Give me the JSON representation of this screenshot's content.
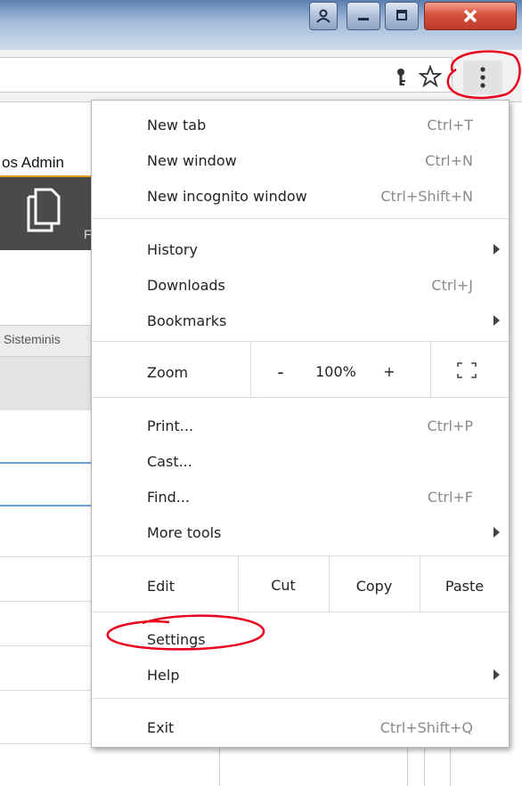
{
  "browser_ui": {
    "left_tab_text": "os Admin",
    "left_tab_text2": "Sisteminis",
    "left_icon_text": "F"
  },
  "menu": {
    "new_tab": {
      "label": "New tab",
      "shortcut": "Ctrl+T"
    },
    "new_window": {
      "label": "New window",
      "shortcut": "Ctrl+N"
    },
    "incognito": {
      "label": "New incognito window",
      "shortcut": "Ctrl+Shift+N"
    },
    "history": {
      "label": "History"
    },
    "downloads": {
      "label": "Downloads",
      "shortcut": "Ctrl+J"
    },
    "bookmarks": {
      "label": "Bookmarks"
    },
    "zoom": {
      "label": "Zoom",
      "minus": "-",
      "value": "100%",
      "plus": "+"
    },
    "print": {
      "label": "Print...",
      "shortcut": "Ctrl+P"
    },
    "cast": {
      "label": "Cast..."
    },
    "find": {
      "label": "Find...",
      "shortcut": "Ctrl+F"
    },
    "more_tools": {
      "label": "More tools"
    },
    "edit": {
      "label": "Edit",
      "cut": "Cut",
      "copy": "Copy",
      "paste": "Paste"
    },
    "settings": {
      "label": "Settings"
    },
    "help": {
      "label": "Help"
    },
    "exit": {
      "label": "Exit",
      "shortcut": "Ctrl+Shift+Q"
    }
  },
  "colors": {
    "annotation": "#e8001c",
    "accent_orange": "#e0a11b",
    "dark_panel": "#4a4a4a"
  },
  "icons": [
    "user-icon",
    "minimize-icon",
    "maximize-icon",
    "close-icon",
    "key-icon",
    "star-icon",
    "menu-dots-icon",
    "document-icon",
    "fullscreen-icon",
    "arrow-icon"
  ]
}
